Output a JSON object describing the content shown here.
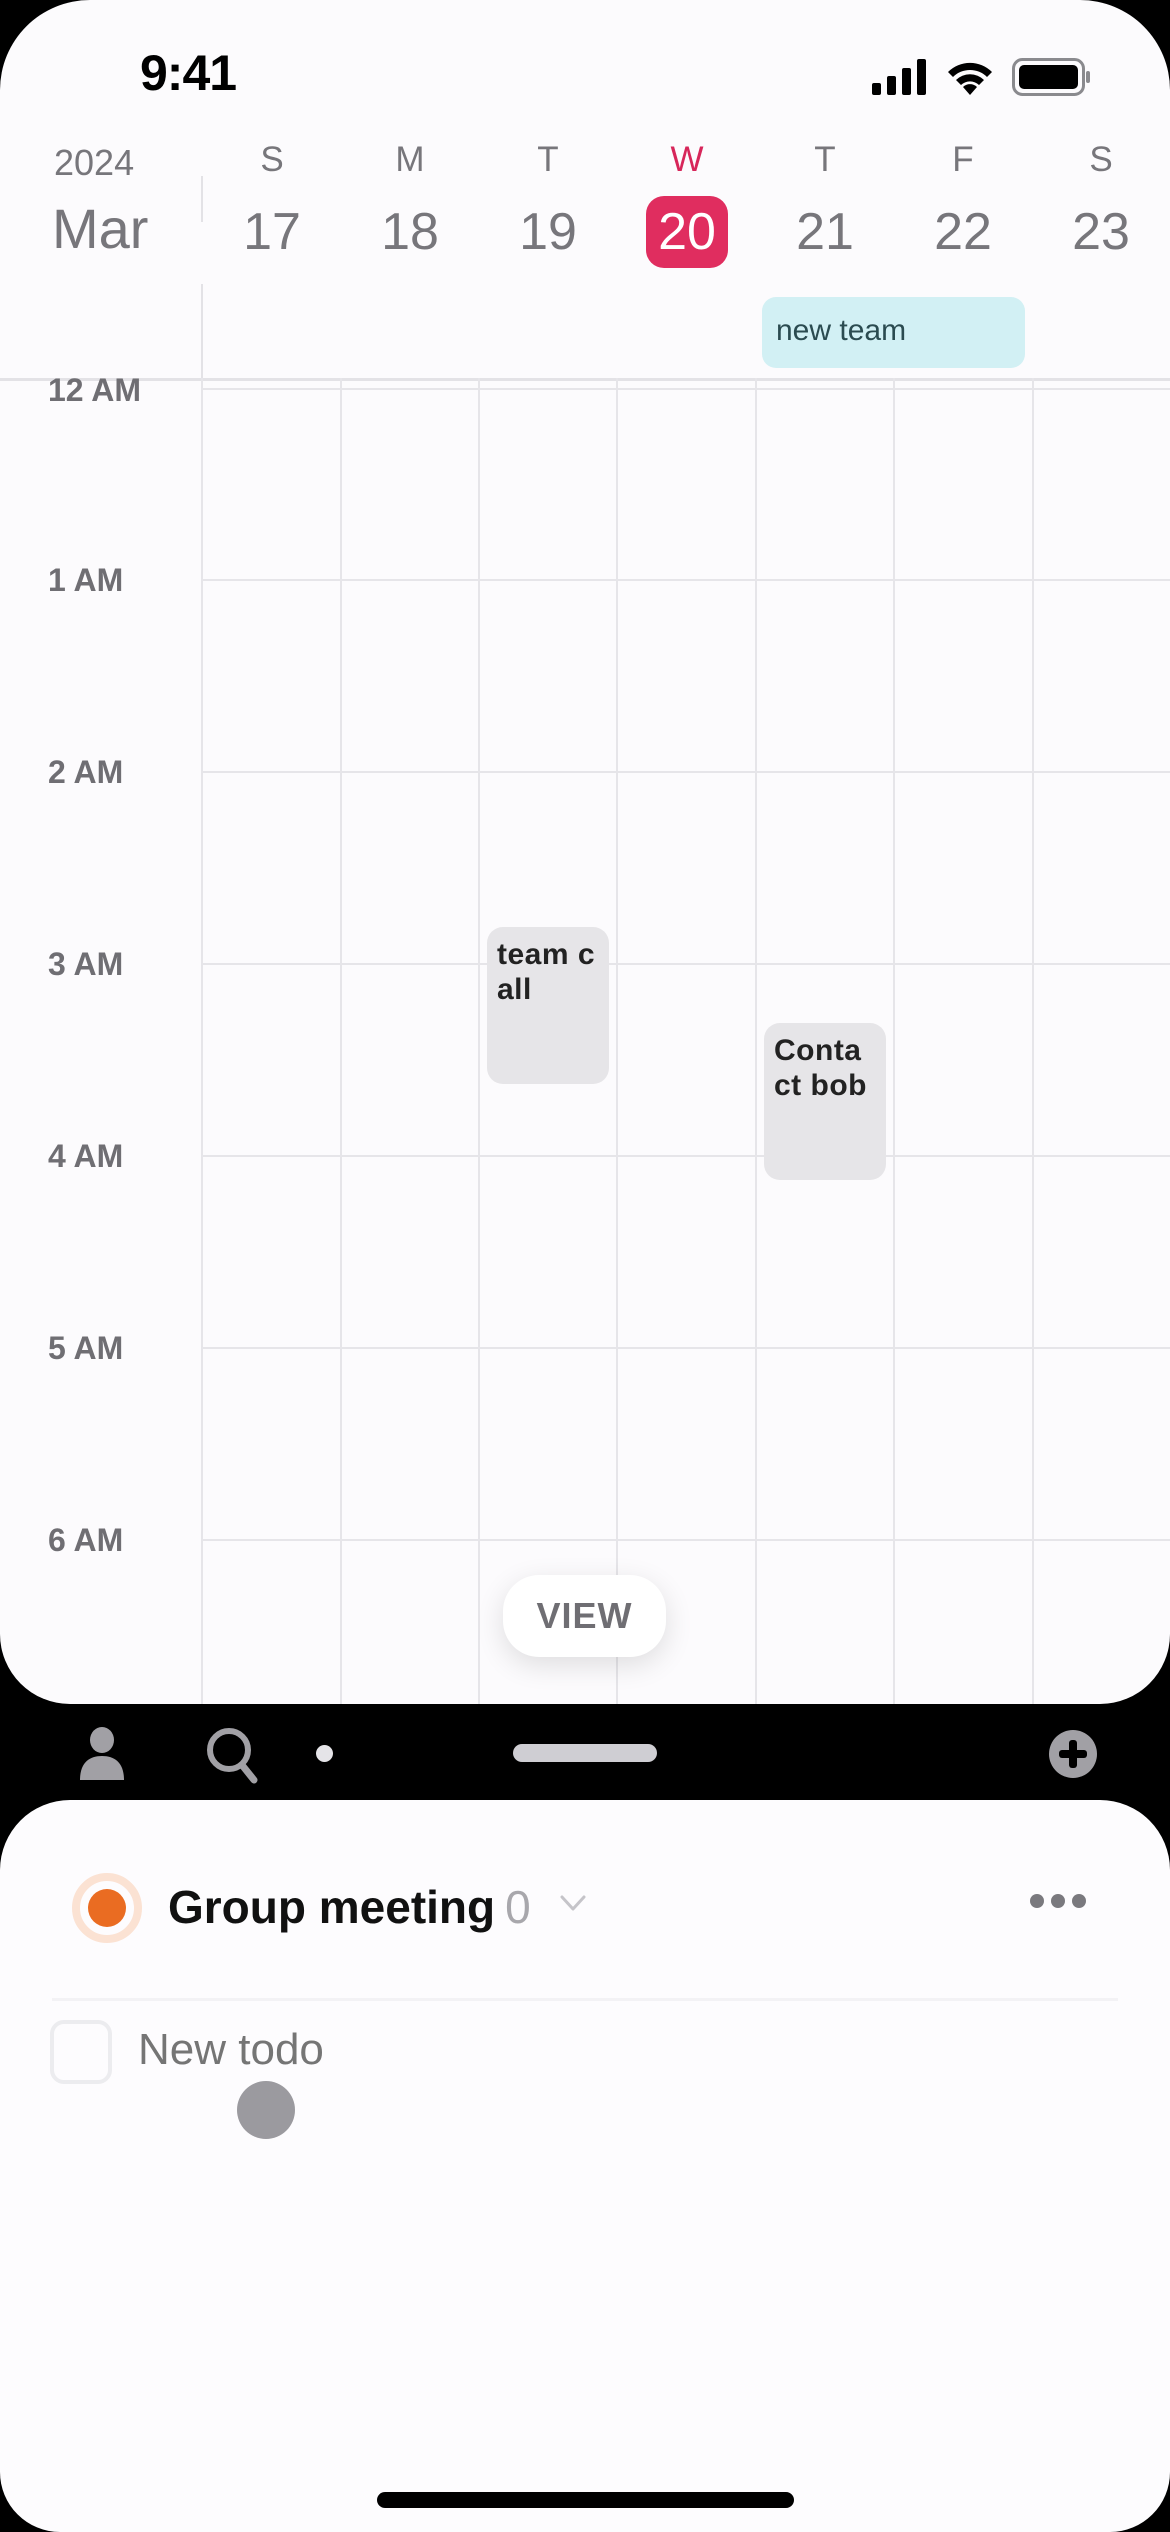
{
  "status_bar": {
    "time": "9:41",
    "icons": [
      "cellular-signal-icon",
      "wifi-icon",
      "battery-icon"
    ]
  },
  "calendar": {
    "year": "2024",
    "month": "Mar",
    "days": [
      {
        "letter": "S",
        "number": "17",
        "today": false
      },
      {
        "letter": "M",
        "number": "18",
        "today": false
      },
      {
        "letter": "T",
        "number": "19",
        "today": false
      },
      {
        "letter": "W",
        "number": "20",
        "today": true
      },
      {
        "letter": "T",
        "number": "21",
        "today": false
      },
      {
        "letter": "F",
        "number": "22",
        "today": false
      },
      {
        "letter": "S",
        "number": "23",
        "today": false
      }
    ],
    "all_day_events": [
      {
        "title": "new team",
        "day": "21",
        "color": "#d2f0f4"
      }
    ],
    "hours": [
      "12 AM",
      "1 AM",
      "2 AM",
      "3 AM",
      "4 AM",
      "5 AM",
      "6 AM"
    ],
    "events": [
      {
        "title": "team call",
        "day": "19",
        "start_hour": 2.8,
        "end_hour": 3.6
      },
      {
        "title": "Contact bob",
        "day": "21",
        "start_hour": 3.3,
        "end_hour": 4.1
      }
    ],
    "view_button": "VIEW",
    "today_color": "#e02d5f"
  },
  "toolbar": {
    "icons": [
      "profile-icon",
      "search-icon",
      "dot-indicator",
      "drag-handle",
      "add-icon"
    ]
  },
  "list": {
    "title": "Group meeting",
    "count": "0",
    "accent_color": "#ea6c22",
    "new_todo_placeholder": "New todo"
  }
}
